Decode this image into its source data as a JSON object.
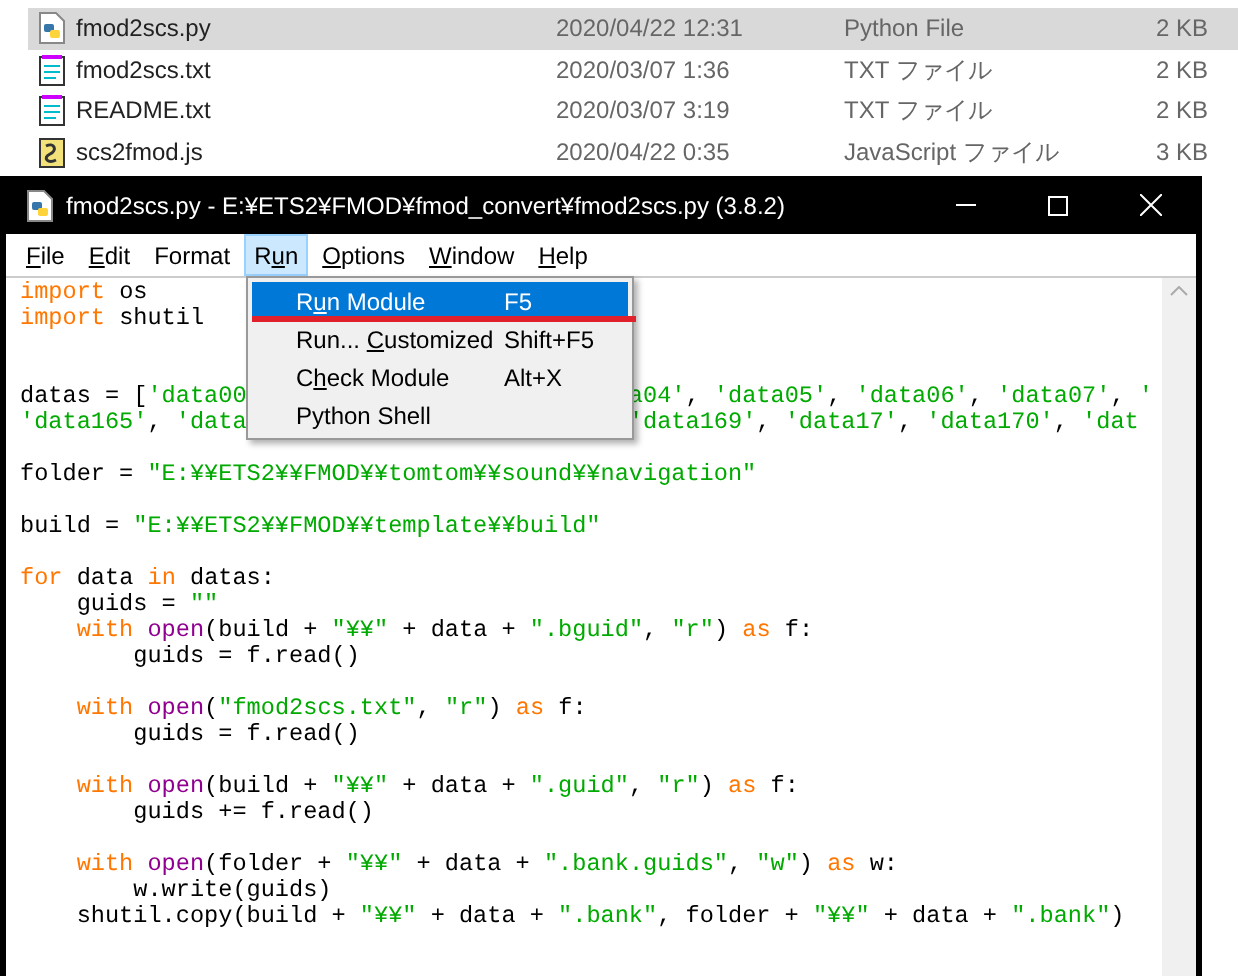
{
  "files": [
    {
      "name": "fmod2scs.py",
      "date": "2020/04/22 12:31",
      "type": "Python File",
      "size": "2 KB",
      "kind": "python",
      "selected": true
    },
    {
      "name": "fmod2scs.txt",
      "date": "2020/03/07 1:36",
      "type": "TXT ファイル",
      "size": "2 KB",
      "kind": "text",
      "selected": false
    },
    {
      "name": "README.txt",
      "date": "2020/03/07 3:19",
      "type": "TXT ファイル",
      "size": "2 KB",
      "kind": "text",
      "selected": false
    },
    {
      "name": "scs2fmod.js",
      "date": "2020/04/22 0:35",
      "type": "JavaScript ファイル",
      "size": "3 KB",
      "kind": "script",
      "selected": false
    }
  ],
  "window": {
    "title": "fmod2scs.py - E:¥ETS2¥FMOD¥fmod_convert¥fmod2scs.py (3.8.2)"
  },
  "menu_bar": [
    {
      "key": "F",
      "after": "ile",
      "selected": false
    },
    {
      "key": "E",
      "after": "dit",
      "selected": false
    },
    {
      "before": "Format",
      "selected": false
    },
    {
      "before": "R",
      "key": "u",
      "after": "n",
      "selected": true
    },
    {
      "key": "O",
      "after": "ptions",
      "selected": false
    },
    {
      "key": "W",
      "after": "indow",
      "selected": false
    },
    {
      "key": "H",
      "after": "elp",
      "selected": false
    }
  ],
  "run_menu": [
    {
      "before": "R",
      "key": "u",
      "after": "n Module",
      "shortcut": "F5",
      "selected": true
    },
    {
      "before": "Run... ",
      "key": "C",
      "after": "ustomized",
      "shortcut": "Shift+F5",
      "selected": false
    },
    {
      "before": "C",
      "key": "h",
      "after": "eck Module",
      "shortcut": "Alt+X",
      "selected": false
    },
    {
      "before": "Python Shell",
      "selected": false
    }
  ],
  "code_lines": [
    {
      "kind": "code",
      "tokens": [
        {
          "kind": "keyword",
          "text": "import"
        },
        {
          "kind": "plain",
          "text": " os"
        }
      ]
    },
    {
      "kind": "code",
      "tokens": [
        {
          "kind": "keyword",
          "text": "import"
        },
        {
          "kind": "plain",
          "text": " shutil"
        }
      ]
    },
    {
      "kind": "blank"
    },
    {
      "kind": "blank"
    },
    {
      "kind": "code",
      "tokens": [
        {
          "kind": "plain",
          "text": "datas = ["
        },
        {
          "kind": "string",
          "text": "'data00"
        },
        {
          "kind": "gap"
        },
        {
          "kind": "string",
          "text": "a04'"
        },
        {
          "kind": "plain",
          "text": ", "
        },
        {
          "kind": "string",
          "text": "'data05'"
        },
        {
          "kind": "plain",
          "text": ", "
        },
        {
          "kind": "string",
          "text": "'data06'"
        },
        {
          "kind": "plain",
          "text": ", "
        },
        {
          "kind": "string",
          "text": "'data07'"
        },
        {
          "kind": "plain",
          "text": ", "
        },
        {
          "kind": "string",
          "text": "'"
        }
      ]
    },
    {
      "kind": "code",
      "tokens": [
        {
          "kind": "string",
          "text": "'data165'"
        },
        {
          "kind": "plain",
          "text": ", "
        },
        {
          "kind": "string",
          "text": "'data"
        },
        {
          "kind": "gap"
        },
        {
          "kind": "string",
          "text": "'data169'"
        },
        {
          "kind": "plain",
          "text": ", "
        },
        {
          "kind": "string",
          "text": "'data17'"
        },
        {
          "kind": "plain",
          "text": ", "
        },
        {
          "kind": "string",
          "text": "'data170'"
        },
        {
          "kind": "plain",
          "text": ", "
        },
        {
          "kind": "string",
          "text": "'dat"
        }
      ]
    },
    {
      "kind": "blank"
    },
    {
      "kind": "code",
      "tokens": [
        {
          "kind": "plain",
          "text": "folder = "
        },
        {
          "kind": "string",
          "text": "\"E:¥¥ETS2¥¥FMOD¥¥tomtom¥¥sound¥¥navigation\""
        }
      ]
    },
    {
      "kind": "blank"
    },
    {
      "kind": "code",
      "tokens": [
        {
          "kind": "plain",
          "text": "build = "
        },
        {
          "kind": "string",
          "text": "\"E:¥¥ETS2¥¥FMOD¥¥template¥¥build\""
        }
      ]
    },
    {
      "kind": "blank"
    },
    {
      "kind": "code",
      "tokens": [
        {
          "kind": "keyword",
          "text": "for"
        },
        {
          "kind": "plain",
          "text": " data "
        },
        {
          "kind": "keyword",
          "text": "in"
        },
        {
          "kind": "plain",
          "text": " datas:"
        }
      ]
    },
    {
      "kind": "code",
      "tokens": [
        {
          "kind": "plain",
          "text": "    guids = "
        },
        {
          "kind": "string",
          "text": "\"\""
        }
      ]
    },
    {
      "kind": "code",
      "indented": true,
      "tokens": [
        {
          "kind": "keyword",
          "text": "with"
        },
        {
          "kind": "builtin",
          "text": "open",
          "space_before": true
        },
        {
          "kind": "plain",
          "text": "(build + "
        },
        {
          "kind": "string",
          "text": "\"¥¥\""
        },
        {
          "kind": "plain",
          "text": " + data + "
        },
        {
          "kind": "string",
          "text": "\".bguid\""
        },
        {
          "kind": "plain",
          "text": ", "
        },
        {
          "kind": "string",
          "text": "\"r\""
        },
        {
          "kind": "plain",
          "text": ") "
        },
        {
          "kind": "keyword",
          "text": "as"
        },
        {
          "kind": "plain",
          "text": " f:"
        }
      ]
    },
    {
      "kind": "code",
      "tokens": [
        {
          "kind": "plain",
          "text": "        guids = f.read()"
        }
      ]
    },
    {
      "kind": "blank"
    },
    {
      "kind": "code",
      "indented": true,
      "tokens": [
        {
          "kind": "keyword",
          "text": "with"
        },
        {
          "kind": "builtin",
          "text": "open",
          "space_before": true
        },
        {
          "kind": "plain",
          "text": "("
        },
        {
          "kind": "string",
          "text": "\"fmod2scs.txt\""
        },
        {
          "kind": "plain",
          "text": ", "
        },
        {
          "kind": "string",
          "text": "\"r\""
        },
        {
          "kind": "plain",
          "text": ") "
        },
        {
          "kind": "keyword",
          "text": "as"
        },
        {
          "kind": "plain",
          "text": " f:"
        }
      ]
    },
    {
      "kind": "code",
      "tokens": [
        {
          "kind": "plain",
          "text": "        guids = f.read()"
        }
      ]
    },
    {
      "kind": "blank"
    },
    {
      "kind": "code",
      "indented": true,
      "tokens": [
        {
          "kind": "keyword",
          "text": "with"
        },
        {
          "kind": "builtin",
          "text": "open",
          "space_before": true
        },
        {
          "kind": "plain",
          "text": "(build + "
        },
        {
          "kind": "string",
          "text": "\"¥¥\""
        },
        {
          "kind": "plain",
          "text": " + data + "
        },
        {
          "kind": "string",
          "text": "\".guid\""
        },
        {
          "kind": "plain",
          "text": ", "
        },
        {
          "kind": "string",
          "text": "\"r\""
        },
        {
          "kind": "plain",
          "text": ") "
        },
        {
          "kind": "keyword",
          "text": "as"
        },
        {
          "kind": "plain",
          "text": " f:"
        }
      ]
    },
    {
      "kind": "code",
      "tokens": [
        {
          "kind": "plain",
          "text": "        guids += f.read()"
        }
      ]
    },
    {
      "kind": "blank"
    },
    {
      "kind": "code",
      "indented": true,
      "tokens": [
        {
          "kind": "keyword",
          "text": "with"
        },
        {
          "kind": "builtin",
          "text": "open",
          "space_before": true
        },
        {
          "kind": "plain",
          "text": "(folder + "
        },
        {
          "kind": "string",
          "text": "\"¥¥\""
        },
        {
          "kind": "plain",
          "text": " + data + "
        },
        {
          "kind": "string",
          "text": "\".bank.guids\""
        },
        {
          "kind": "plain",
          "text": ", "
        },
        {
          "kind": "string",
          "text": "\"w\""
        },
        {
          "kind": "plain",
          "text": ") "
        },
        {
          "kind": "keyword",
          "text": "as"
        },
        {
          "kind": "plain",
          "text": " w:"
        }
      ]
    },
    {
      "kind": "code",
      "tokens": [
        {
          "kind": "plain",
          "text": "        w.write(guids)"
        }
      ]
    },
    {
      "kind": "code",
      "tokens": [
        {
          "kind": "plain",
          "text": "    shutil.copy(build + "
        },
        {
          "kind": "string",
          "text": "\"¥¥\""
        },
        {
          "kind": "plain",
          "text": " + data + "
        },
        {
          "kind": "string",
          "text": "\".bank\""
        },
        {
          "kind": "plain",
          "text": ", folder + "
        },
        {
          "kind": "string",
          "text": "\"¥¥\""
        },
        {
          "kind": "plain",
          "text": " + data + "
        },
        {
          "kind": "string",
          "text": "\".bank\""
        },
        {
          "kind": "plain",
          "text": ")"
        }
      ]
    }
  ]
}
